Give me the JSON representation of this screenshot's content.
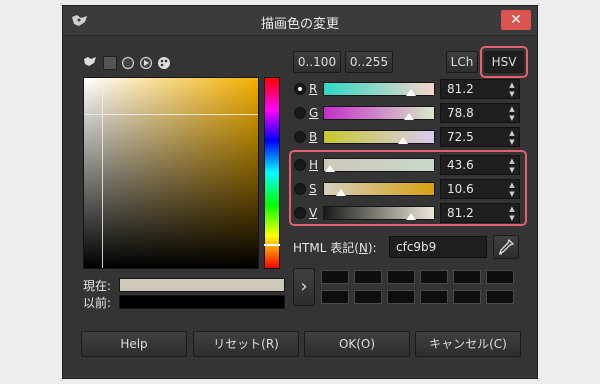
{
  "window": {
    "title": "描画色の変更",
    "close_icon": "close-icon"
  },
  "mode_tabs": [
    "gimp-icon",
    "watercolor-icon",
    "circle-icon",
    "triangle-icon",
    "palette-icon"
  ],
  "range_buttons": [
    "0..100",
    "0..255"
  ],
  "model_buttons": {
    "lch": "LCh",
    "hsv": "HSV"
  },
  "channels": [
    {
      "id": "R",
      "label": "R",
      "value": "81.2",
      "selected": true,
      "gradient": [
        "#2fd8c6",
        "#f7d5c8"
      ],
      "fraction": 0.812
    },
    {
      "id": "G",
      "label": "G",
      "value": "78.8",
      "selected": false,
      "gradient": [
        "#c42fc8",
        "#d8e8c8"
      ],
      "fraction": 0.788
    },
    {
      "id": "B",
      "label": "B",
      "value": "72.5",
      "selected": false,
      "gradient": [
        "#c8c82f",
        "#d8ccf0"
      ],
      "fraction": 0.725
    },
    {
      "id": "H",
      "label": "H",
      "value": "43.6",
      "selected": false,
      "gradient": [
        "#cfc8b8",
        "#c8d8cc"
      ],
      "fraction": 0.0
    },
    {
      "id": "S",
      "label": "S",
      "value": "10.6",
      "selected": false,
      "gradient": [
        "#d6cfbe",
        "#d8a010"
      ],
      "fraction": 0.106
    },
    {
      "id": "V",
      "label": "V",
      "value": "81.2",
      "selected": false,
      "gradient": [
        "#1a1a1a",
        "#ede8d8"
      ],
      "fraction": 0.812
    }
  ],
  "html": {
    "label": "HTML 表記(",
    "mnemonic": "N",
    "label_end": "):",
    "value": "cfc9b9",
    "picker_icon": "eyedropper-icon"
  },
  "swatches": {
    "current_label": "現在:",
    "previous_label": "以前:",
    "current_color": "#cfc9b9",
    "previous_color": "#000000"
  },
  "history_arrow": "›",
  "buttons": {
    "help": "Help",
    "reset": "リセット(R)",
    "ok": "OK(O)",
    "cancel": "キャンセル(C)"
  }
}
